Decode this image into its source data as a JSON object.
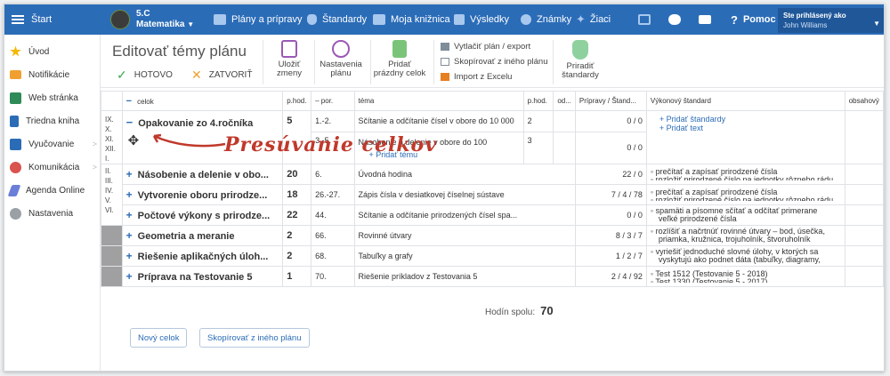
{
  "topbar": {
    "home": "Štart",
    "class_name": "5.C",
    "class_subject": "Matematika",
    "plans": "Plány a prípravy",
    "standards": "Štandardy",
    "library": "Moja knižnica",
    "results": "Výsledky",
    "grades": "Známky",
    "students": "Žiaci",
    "help": "Pomoc",
    "user_title": "Ste prihlásený ako",
    "user_name": "John Williams"
  },
  "sidebar": {
    "items": [
      {
        "label": "Úvod",
        "icon": "star-icon"
      },
      {
        "label": "Notifikácie",
        "icon": "mail-icon"
      },
      {
        "label": "Web stránka",
        "icon": "home-icon"
      },
      {
        "label": "Triedna kniha",
        "icon": "book-icon"
      },
      {
        "label": "Vyučovanie",
        "icon": "teaching-icon"
      },
      {
        "label": "Komunikácia",
        "icon": "chat-icon"
      },
      {
        "label": "Agenda Online",
        "icon": "pen-icon"
      },
      {
        "label": "Nastavenia",
        "icon": "gear-icon"
      }
    ]
  },
  "toolbar": {
    "title": "Editovať témy plánu",
    "done": "HOTOVO",
    "close": "ZATVORIŤ",
    "save_l1": "Uložiť",
    "save_l2": "zmeny",
    "settings_l1": "Nastavenia",
    "settings_l2": "plánu",
    "add_l1": "Pridať",
    "add_l2": "prázdny celok",
    "print": "Vytlačiť plán / export",
    "copy": "Skopírovať z iného plánu",
    "import": "Import z Excelu",
    "assign_l1": "Priradiť",
    "assign_l2": "štandardy"
  },
  "columns": {
    "celok": "celok",
    "phod": "p.hod.",
    "por": "por.",
    "tema": "téma",
    "phod2": "p.hod.",
    "od": "od...",
    "pripravy": "Prípravy / Štand...",
    "vykonovy": "Výkonový štandard",
    "obsahovy": "obsahový"
  },
  "roman": [
    "IX.",
    "X.",
    "XI.",
    "XII.",
    "I.",
    "II.",
    "III.",
    "IV.",
    "V.",
    "VI."
  ],
  "rows": [
    {
      "celok": "Opakovanie zo 4.ročníka",
      "phod": "5",
      "por": "1.-2.",
      "tema": "Sčítanie a odčítanie čísel v obore do 10 000",
      "phod2": "2",
      "prip": "0 / 0",
      "add_std": "+ Pridať štandardy",
      "add_text": "+ Pridať text"
    },
    {
      "celok": "",
      "phod": "",
      "por": "3.-5.",
      "tema": "Násobenie a delenie v obore do 100",
      "phod2": "3",
      "prip": "0 / 0",
      "add_topic": "+ Pridať tému"
    },
    {
      "celok": "Násobenie a delenie v obo...",
      "phod": "20",
      "por": "6.",
      "tema": "Úvodná hodina",
      "prip": "22 / 0",
      "vs1": "◦ prečítať a zapísať prirodzené čísla",
      "vs2": "◦ rozložiť prirodzené číslo na jednotky rôzneho rádu"
    },
    {
      "celok": "Vytvorenie oboru prirodze...",
      "phod": "18",
      "por": "26.-27.",
      "tema": "Zápis čísla v desiatkovej číselnej sústave",
      "prip": "7 / 4 / 78",
      "vs1": "◦ prečítať a zapísať prirodzené čísla",
      "vs2": "◦ rozložiť prirodzené číslo na jednotky rôzneho rádu"
    },
    {
      "celok": "Počtové výkony s prirodze...",
      "phod": "22",
      "por": "44.",
      "tema": "Sčítanie a odčítanie prirodzených čísel spa...",
      "prip": "0 / 0",
      "vs1": "◦ spamäti a písomne sčítať a odčítať primerane",
      "vs2": "veľké prirodzené čísla"
    },
    {
      "celok": "Geometria a meranie",
      "phod": "2",
      "por": "66.",
      "tema": "Rovinné útvary",
      "prip": "8 / 3 / 7",
      "vs1": "◦ rozlíšiť a načrtnúť rovinné útvary – bod, úsečka,",
      "vs2": "priamka, kružnica, trojuholník, štvoruholník"
    },
    {
      "celok": "Riešenie aplikačných úloh...",
      "phod": "2",
      "por": "68.",
      "tema": "Tabuľky a grafy",
      "prip": "1 / 2 / 7",
      "vs1": "◦ vyriešiť jednoduché slovné úlohy, v ktorých sa",
      "vs2": "vyskytujú ako podnet dáta (tabuľky, diagramy,"
    },
    {
      "celok": "Príprava na Testovanie 5",
      "phod": "1",
      "por": "70.",
      "tema": "Riešenie príkladov z Testovania 5",
      "prip": "2 / 4 / 92",
      "vs1": "◦ Test 1512 (Testovanie 5 - 2018)",
      "vs2": "◦ Test 1330 (Testovanie 5 - 2017)"
    }
  ],
  "footer": {
    "total_label": "Hodín spolu:",
    "total": "70",
    "new_unit": "Nový celok",
    "copy_plan": "Skopírovať z iného plánu"
  },
  "annotation": "Presúvanie celkov"
}
